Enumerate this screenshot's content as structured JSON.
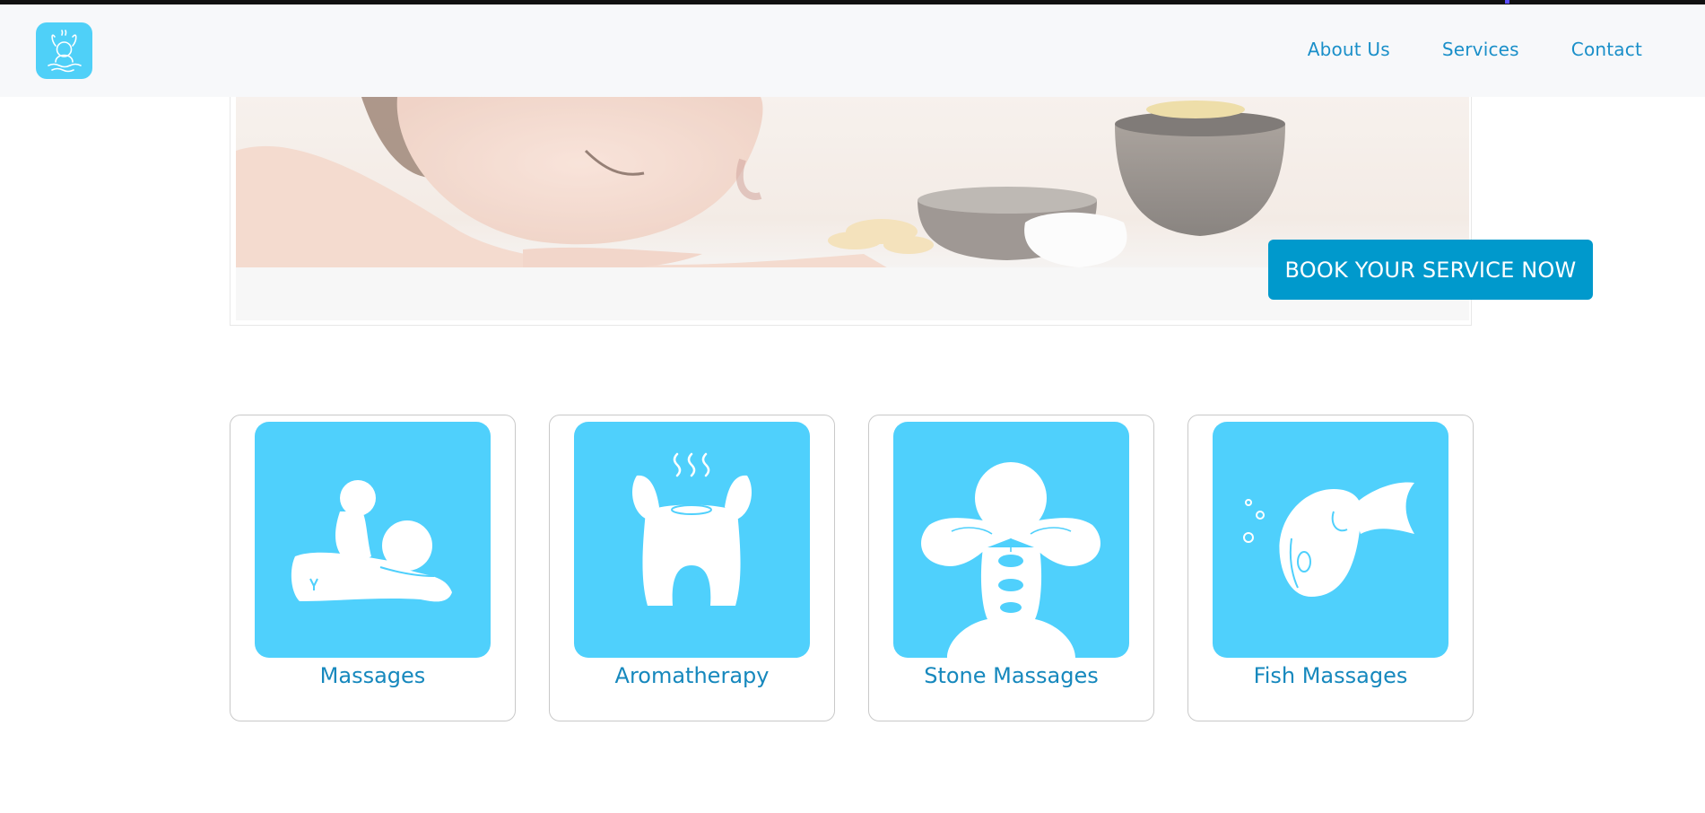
{
  "nav": {
    "logo_icon": "spa-bunny-logo-icon",
    "links": [
      "About Us",
      "Services",
      "Contact"
    ]
  },
  "hero": {
    "image": "woman-relaxing-spa-photo",
    "cta_label": "BOOK YOUR SERVICE NOW"
  },
  "services": [
    {
      "label": "Massages",
      "icon": "massage-icon"
    },
    {
      "label": "Aromatherapy",
      "icon": "aromatherapy-icon"
    },
    {
      "label": "Stone Massages",
      "icon": "stone-massage-icon"
    },
    {
      "label": "Fish Massages",
      "icon": "fish-massage-icon"
    }
  ],
  "colors": {
    "accent": "#0099cc",
    "link": "#1a8fc9",
    "tile": "#4fd0fc",
    "navbar_bg": "#f7f8fa"
  }
}
